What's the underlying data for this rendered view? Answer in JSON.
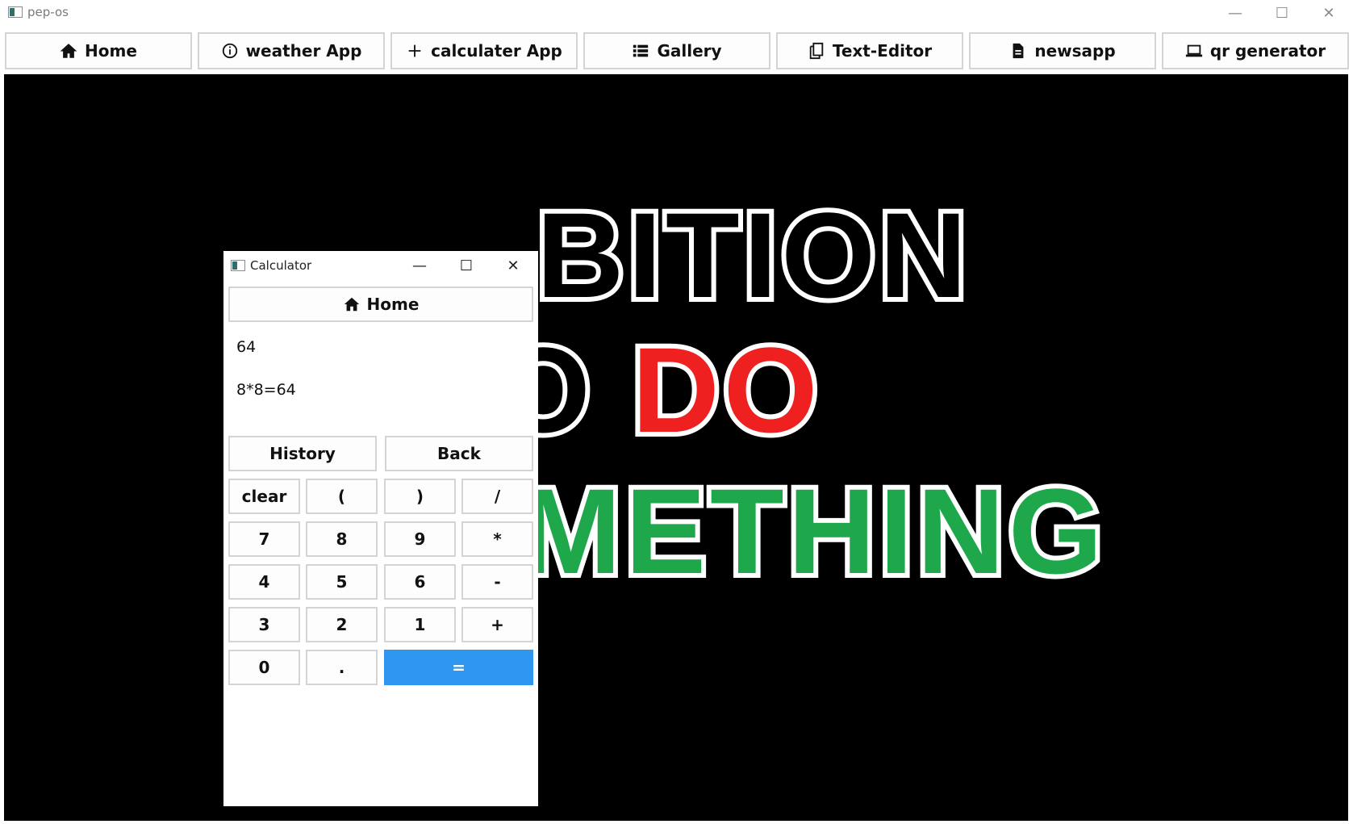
{
  "window": {
    "title": "pep-os",
    "controls": {
      "minimize": "—",
      "maximize": "☐",
      "close": "✕"
    }
  },
  "nav": {
    "items": [
      {
        "label": "Home",
        "icon": "home-icon"
      },
      {
        "label": "weather App",
        "icon": "info-icon"
      },
      {
        "label": "calculater App",
        "icon": "plus-icon"
      },
      {
        "label": "Gallery",
        "icon": "list-icon"
      },
      {
        "label": "Text-Editor",
        "icon": "copy-icon"
      },
      {
        "label": "newsapp",
        "icon": "document-icon"
      },
      {
        "label": "qr generator",
        "icon": "laptop-icon"
      }
    ]
  },
  "wallpaper": {
    "line1": "BITION",
    "line2_black": "O ",
    "line2_red": "DO",
    "line3": "METHING",
    "colors": {
      "black": "#000000",
      "red": "#ee2020",
      "green": "#1fa84b"
    }
  },
  "calculator": {
    "title": "Calculator",
    "home_label": "Home",
    "result": "64",
    "expression": "8*8=64",
    "keys": {
      "history": "History",
      "back": "Back",
      "clear": "clear",
      "open_paren": "(",
      "close_paren": ")",
      "divide": "/",
      "seven": "7",
      "eight": "8",
      "nine": "9",
      "multiply": "*",
      "four": "4",
      "five": "5",
      "six": "6",
      "minus": "-",
      "three": "3",
      "two": "2",
      "one": "1",
      "plus": "+",
      "zero": "0",
      "dot": ".",
      "equals": "="
    },
    "accent": "#2f97ef"
  }
}
